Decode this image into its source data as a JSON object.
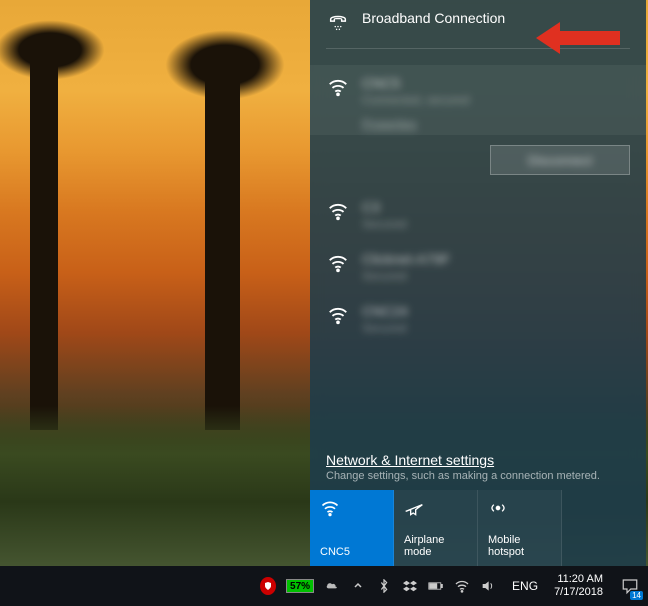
{
  "flyout": {
    "broadband": {
      "label": "Broadband Connection"
    },
    "connected": {
      "name": "CNC5",
      "status": "Connected, secured",
      "properties": "Properties",
      "disconnect": "Disconnect"
    },
    "networks": [
      {
        "name": "C3",
        "status": "Secured"
      },
      {
        "name": "Clicknet-A79F",
        "status": "Secured"
      },
      {
        "name": "CNC24",
        "status": "Secured"
      }
    ],
    "settings_link": "Network & Internet settings",
    "settings_sub": "Change settings, such as making a connection metered.",
    "tiles": {
      "wifi": "CNC5",
      "airplane": "Airplane mode",
      "hotspot": "Mobile hotspot"
    }
  },
  "taskbar": {
    "battery": "57%",
    "lang": "ENG",
    "time": "11:20 AM",
    "date": "7/17/2018",
    "notif_count": "14"
  }
}
